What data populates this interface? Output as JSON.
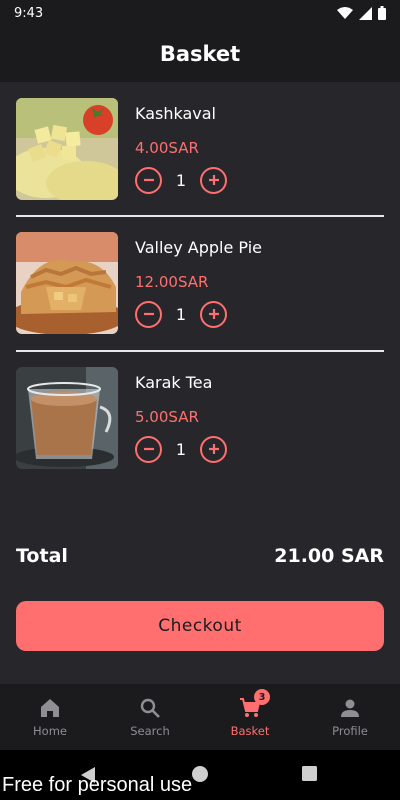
{
  "status": {
    "time": "9:43"
  },
  "header": {
    "title": "Basket"
  },
  "items": [
    {
      "name": "Kashkaval",
      "price": "4.00SAR",
      "qty": "1"
    },
    {
      "name": "Valley Apple Pie",
      "price": "12.00SAR",
      "qty": "1"
    },
    {
      "name": "Karak Tea",
      "price": "5.00SAR",
      "qty": "1"
    }
  ],
  "total": {
    "label": "Total",
    "value": "21.00 SAR"
  },
  "checkout": {
    "label": "Checkout"
  },
  "nav": {
    "items": [
      {
        "label": "Home",
        "icon": "home-icon"
      },
      {
        "label": "Search",
        "icon": "search-icon"
      },
      {
        "label": "Basket",
        "icon": "cart-icon",
        "badge": "3",
        "active": true
      },
      {
        "label": "Profile",
        "icon": "person-icon"
      }
    ]
  },
  "watermark": "Free for personal use",
  "colors": {
    "accent": "#ff6f6f",
    "background": "#27272b",
    "bar": "#1b1b1e"
  }
}
